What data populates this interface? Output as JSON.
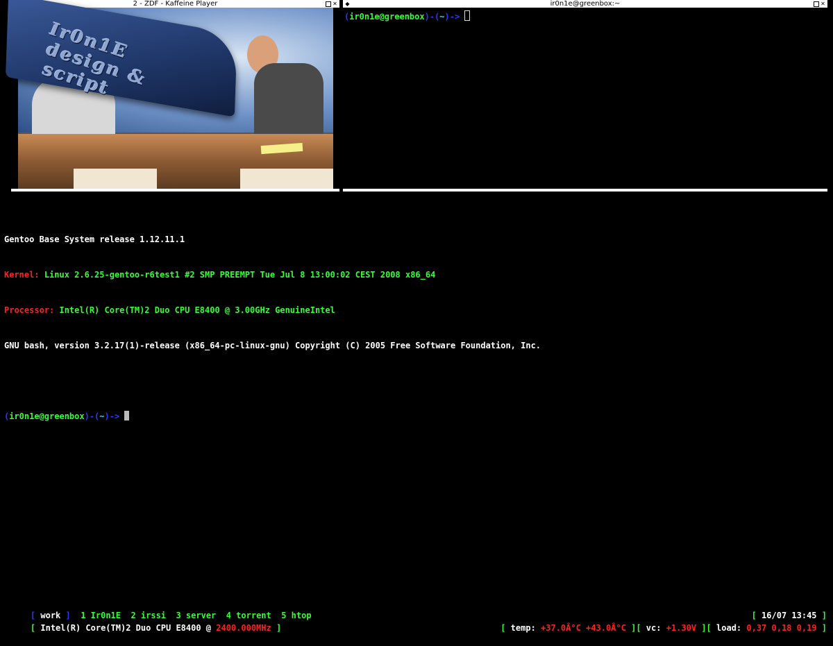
{
  "video_window": {
    "title": "2 - ZDF - Kaffeine Player",
    "logo_text": "Ir0n1E design & script"
  },
  "terminal_window": {
    "title": "ir0n1e@greenbox:~",
    "prompt": {
      "open": "(",
      "user_host": "ir0n1e@greenbox",
      "sep": ")-(",
      "dir": "~",
      "close": ")->"
    }
  },
  "main_terminal": {
    "release": "Gentoo Base System release 1.12.11.1",
    "kernel_label": "Kernel:",
    "kernel_value": "Linux 2.6.25-gentoo-r6test1 #2 SMP PREEMPT Tue Jul 8 13:00:02 CEST 2008 x86_64",
    "processor_label": "Processor:",
    "processor_value": "Intel(R) Core(TM)2 Duo CPU E8400 @ 3.00GHz GenuineIntel",
    "bash": "GNU bash, version 3.2.17(1)-release (x86_64-pc-linux-gnu) Copyright (C) 2005 Free Software Foundation, Inc.",
    "prompt": {
      "open": "(",
      "user_host": "ir0n1e@greenbox",
      "sep": ")-(",
      "dir": "~",
      "close": ")->"
    }
  },
  "status_bar": {
    "workspaces": [
      {
        "label": "work",
        "active": true
      },
      {
        "label": "1 Ir0n1E",
        "active": false
      },
      {
        "label": "2 irssi",
        "active": false
      },
      {
        "label": "3 server",
        "active": false
      },
      {
        "label": "4 torrent",
        "active": false
      },
      {
        "label": "5 htop",
        "active": false
      }
    ],
    "bracket_open": "[",
    "bracket_close": "]",
    "datetime": "16/07 13:45",
    "cpu_label": "Intel(R) Core(TM)2 Duo CPU E8400 @",
    "cpu_freq": "2400.000MHz",
    "temp_label": "temp:",
    "temp_values": "+37.0Â°C +43.0Â°C",
    "vc_label": "vc:",
    "vc_value": "+1.30V",
    "load_label": "load:",
    "load_values": "0,37 0,18 0,19"
  },
  "colors": {
    "background": "#000000",
    "red": "#ff2020",
    "green": "#33ff33",
    "blue": "#2a3aff",
    "cyan": "#33d6ff"
  }
}
